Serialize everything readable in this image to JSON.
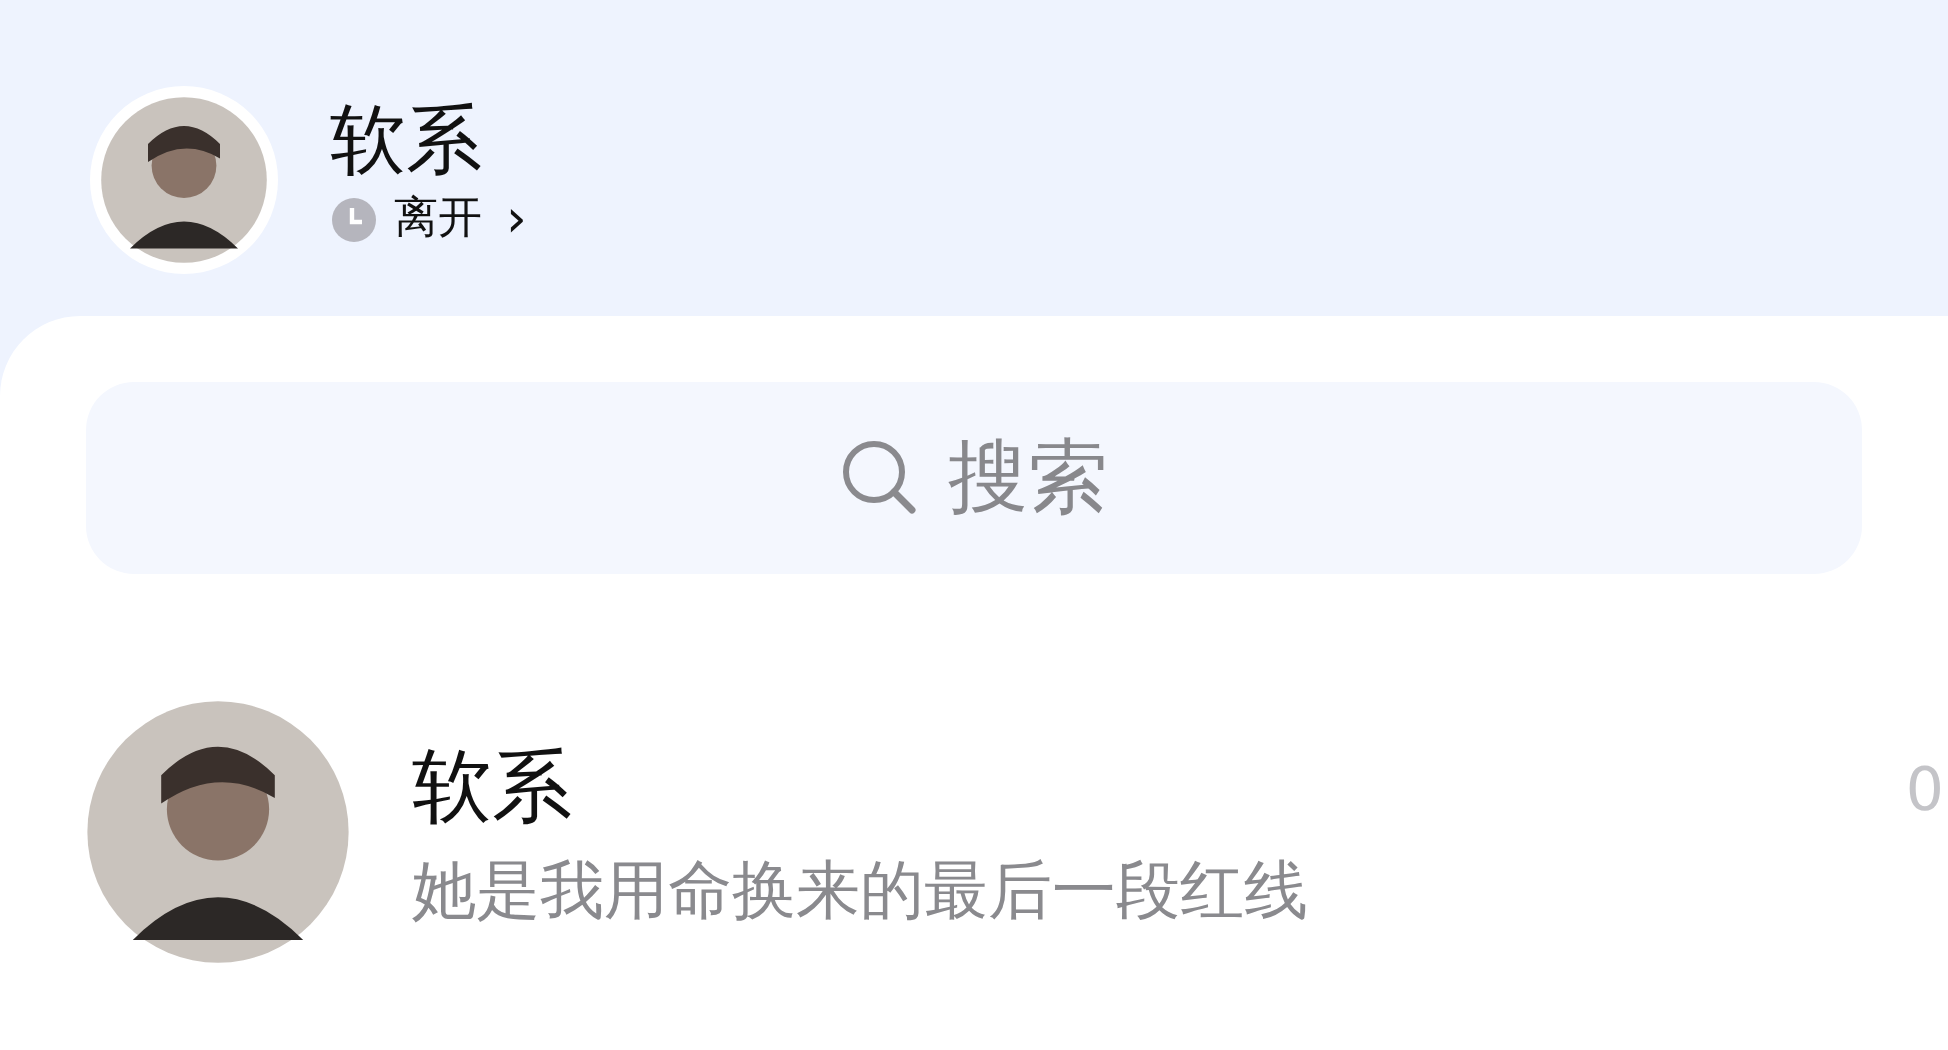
{
  "header": {
    "name": "软系",
    "status": "离开",
    "chevron": "›"
  },
  "search": {
    "placeholder": "搜索"
  },
  "conversations": [
    {
      "name": "软系",
      "message": "她是我用命换来的最后一段红线",
      "time": "0"
    }
  ]
}
